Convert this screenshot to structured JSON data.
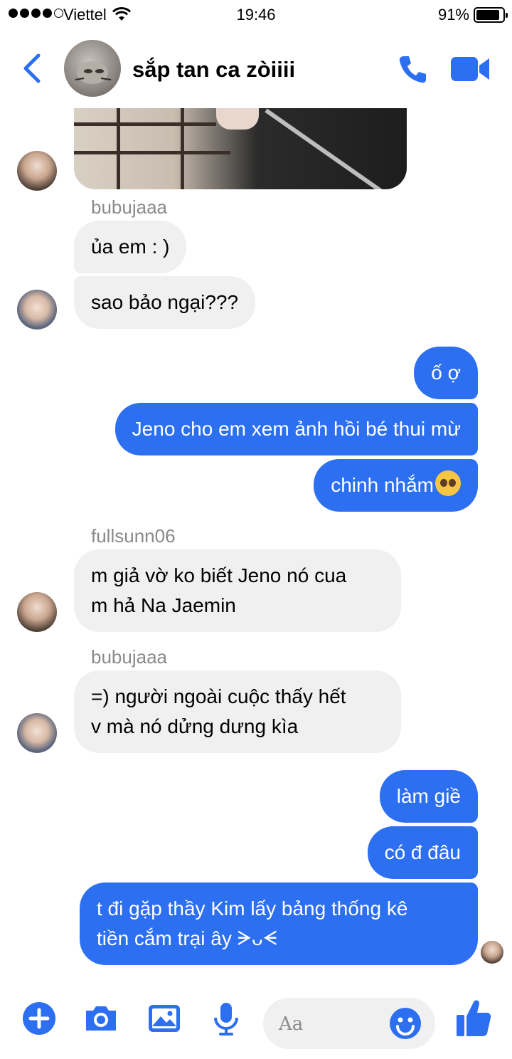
{
  "status": {
    "carrier": "Viettel",
    "time": "19:46",
    "battery": "91%",
    "battery_level": 0.91
  },
  "header": {
    "title": "sắp tan ca zòiiii"
  },
  "messages": {
    "sender1": "bubujaaa",
    "m1": "ủa em : )",
    "m2": "sao bảo ngại???",
    "m3": "ố ợ",
    "m4": "Jeno cho em xem ảnh hồi bé thui mừ",
    "m5": "chinh nhắm",
    "sender2": "fullsunn06",
    "m6_l1": "m giả vờ ko biết Jeno nó cua",
    "m6_l2": "m hả Na Jaemin",
    "sender3": "bubujaaa",
    "m7_l1": "=) người ngoài cuộc thấy hết",
    "m7_l2": "v mà nó dửng dưng kìa",
    "m8": "làm giề",
    "m9": "có đ đâu",
    "m10_l1": "t đi gặp thầy Kim lấy bảng thống kê",
    "m10_l2": "tiền cắm trại ây ᗒᴗᗕ"
  },
  "composer": {
    "placeholder": "Aa"
  },
  "colors": {
    "accent": "#2c6ff0",
    "incoming_bubble": "#f0f0f0",
    "sender_name": "#8a8a8a"
  },
  "icons": [
    "back-icon",
    "phone-icon",
    "video-icon",
    "plus-icon",
    "camera-icon",
    "image-icon",
    "mic-icon",
    "emoji-icon",
    "like-icon"
  ]
}
